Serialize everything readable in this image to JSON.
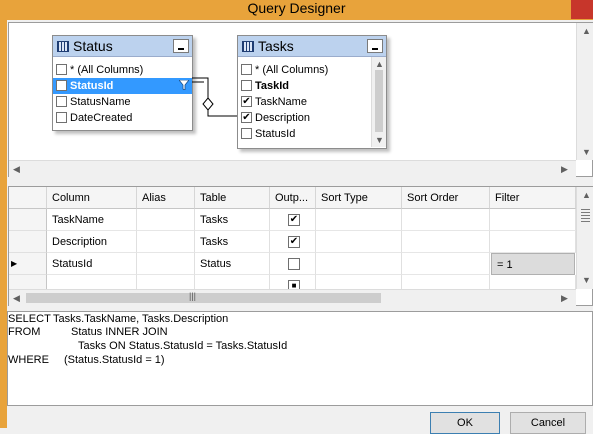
{
  "window": {
    "title": "Query Designer"
  },
  "diagram": {
    "tables": [
      {
        "name": "Status",
        "columns": [
          {
            "label": "* (All Columns)",
            "checked": false,
            "selected": false,
            "bold": false
          },
          {
            "label": "StatusId",
            "checked": false,
            "selected": true,
            "bold": true,
            "filter": true
          },
          {
            "label": "StatusName",
            "checked": false,
            "selected": false,
            "bold": false
          },
          {
            "label": "DateCreated",
            "checked": false,
            "selected": false,
            "bold": false
          }
        ]
      },
      {
        "name": "Tasks",
        "columns": [
          {
            "label": "* (All Columns)",
            "checked": false,
            "bold": false
          },
          {
            "label": "TaskId",
            "checked": false,
            "bold": true
          },
          {
            "label": "TaskName",
            "checked": true,
            "bold": false
          },
          {
            "label": "Description",
            "checked": true,
            "bold": false
          },
          {
            "label": "StatusId",
            "checked": false,
            "bold": false
          }
        ]
      }
    ]
  },
  "grid": {
    "headers": [
      "Column",
      "Alias",
      "Table",
      "Outp...",
      "Sort Type",
      "Sort Order",
      "Filter"
    ],
    "rows": [
      {
        "column": "TaskName",
        "alias": "",
        "table": "Tasks",
        "output": true,
        "sort_type": "",
        "sort_order": "",
        "filter": ""
      },
      {
        "column": "Description",
        "alias": "",
        "table": "Tasks",
        "output": true,
        "sort_type": "",
        "sort_order": "",
        "filter": ""
      },
      {
        "column": "StatusId",
        "alias": "",
        "table": "Status",
        "output": false,
        "sort_type": "",
        "sort_order": "",
        "filter": "= 1",
        "current": true
      },
      {
        "column": "",
        "alias": "",
        "table": "",
        "output": true,
        "sort_type": "",
        "sort_order": "",
        "filter": ""
      }
    ],
    "output_header": "Outp..."
  },
  "sql": {
    "lines": [
      {
        "keyword": "SELECT",
        "text": "Tasks.TaskName, Tasks.Description"
      },
      {
        "keyword": "FROM",
        "text": "Status INNER JOIN"
      },
      {
        "keyword": "",
        "text": "Tasks ON Status.StatusId = Tasks.StatusId"
      },
      {
        "keyword": "WHERE",
        "text": "(Status.StatusId = 1)"
      }
    ]
  },
  "buttons": {
    "ok": "OK",
    "cancel": "Cancel"
  },
  "icons": {
    "check": "✔",
    "filter": "filter-funnel-icon",
    "row_pointer": "▶",
    "minimize": "_"
  },
  "colors": {
    "titlebar": "#e8a33b",
    "selection": "#3399ff",
    "table_header": "#bcd2ee",
    "close": "#c7362b"
  }
}
